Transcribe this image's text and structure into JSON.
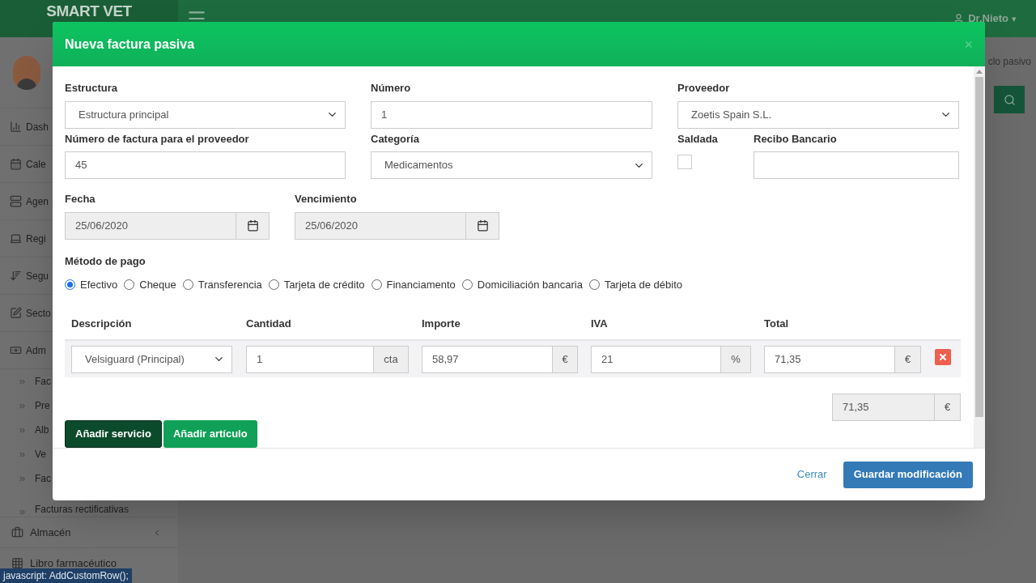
{
  "app": {
    "logo": "SMART VET",
    "user": "Dr.Nieto",
    "user_caret": "▾",
    "breadcrumb": "clo pasivo",
    "sidebar": [
      {
        "label": "Dash",
        "kind": "chart"
      },
      {
        "label": "Cale",
        "kind": "calendar"
      },
      {
        "label": "Agen",
        "kind": "list"
      },
      {
        "label": "Regi",
        "kind": "laptop"
      },
      {
        "label": "Segu",
        "kind": "sort"
      },
      {
        "label": "Secto",
        "kind": "edit"
      },
      {
        "label": "Adm",
        "kind": "money"
      }
    ],
    "subitems": [
      "Fac",
      "Pre",
      "Alb",
      "Ve",
      "Fac",
      "Facturas rectificativas"
    ],
    "more": [
      {
        "label": "Almacén",
        "kind": "box"
      },
      {
        "label": "Libro farmacéutico",
        "kind": "grid"
      }
    ],
    "status_bar": "javascript: AddCustomRow();"
  },
  "modal": {
    "title": "Nueva factura pasiva",
    "close": "×",
    "estructura": {
      "label": "Estructura",
      "value": "Estructura principal"
    },
    "numero": {
      "label": "Número",
      "value": "1"
    },
    "proveedor": {
      "label": "Proveedor",
      "value": "Zoetis Spain S.L."
    },
    "num_factura": {
      "label": "Número de factura para el proveedor",
      "value": "45"
    },
    "categoria": {
      "label": "Categoría",
      "value": "Medicamentos"
    },
    "saldada": {
      "label": "Saldada",
      "checked": false
    },
    "recibo": {
      "label": "Recibo Bancario"
    },
    "fecha": {
      "label": "Fecha",
      "value": "25/06/2020"
    },
    "vencimiento": {
      "label": "Vencimiento",
      "value": "25/06/2020"
    },
    "metodo": {
      "label": "Método de pago",
      "options": [
        {
          "label": "Efectivo",
          "selected": true
        },
        {
          "label": "Cheque",
          "selected": false
        },
        {
          "label": "Transferencia",
          "selected": false
        },
        {
          "label": "Tarjeta de crédito",
          "selected": false
        },
        {
          "label": "Financiamento",
          "selected": false
        },
        {
          "label": "Domiciliación bancaria",
          "selected": false
        },
        {
          "label": "Tarjeta de débito",
          "selected": false
        }
      ]
    },
    "lines": {
      "columns": [
        "Descripción",
        "Cantidad",
        "Importe",
        "IVA",
        "Total"
      ],
      "rows": [
        {
          "descripcion": "Velsiguard (Principal)",
          "cantidad": "1",
          "cantidad_unit": "cta",
          "importe": "58,97",
          "importe_unit": "€",
          "iva": "21",
          "iva_unit": "%",
          "total": "71,35",
          "total_unit": "€"
        }
      ]
    },
    "grand_total": {
      "value": "71,35",
      "unit": "€"
    },
    "actions": [
      "Añadir servicio",
      "Añadir artículo"
    ],
    "footer": {
      "close": "Cerrar",
      "save": "Guardar modificación"
    }
  }
}
